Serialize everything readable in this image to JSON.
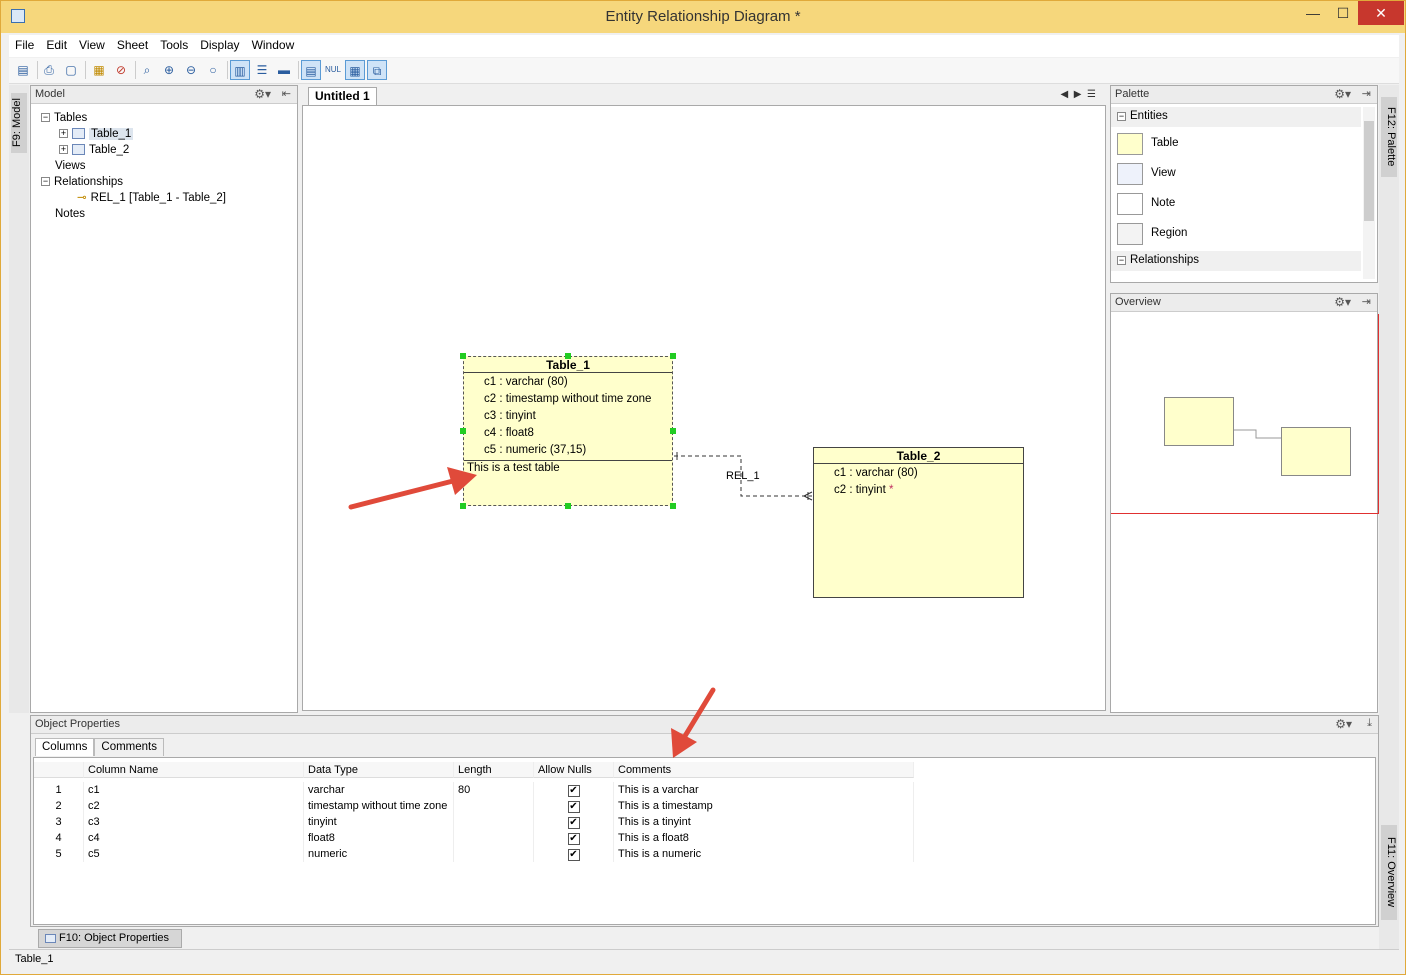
{
  "window": {
    "title": "Entity Relationship Diagram *",
    "minimize": "—",
    "maximize": "☐",
    "close": "✕"
  },
  "menu": [
    "File",
    "Edit",
    "View",
    "Sheet",
    "Tools",
    "Display",
    "Window"
  ],
  "side_left": {
    "model_tab": "F9: Model"
  },
  "side_right": {
    "palette_tab": "F12: Palette",
    "overview_tab": "F11: Overview"
  },
  "model_panel": {
    "title": "Model",
    "tree": {
      "tables": "Tables",
      "table_items": [
        "Table_1",
        "Table_2"
      ],
      "views": "Views",
      "relationships": "Relationships",
      "rel_item": "REL_1 [Table_1 - Table_2]",
      "notes": "Notes"
    }
  },
  "document": {
    "tab": "Untitled 1"
  },
  "diagram": {
    "table1": {
      "name": "Table_1",
      "columns": [
        "c1 : varchar (80)",
        "c2 : timestamp without time zone",
        "c3 : tinyint",
        "c4 : float8",
        "c5 : numeric (37,15)"
      ],
      "note": "This is a test table"
    },
    "table2": {
      "name": "Table_2",
      "columns": [
        "c1 : varchar (80)",
        "c2 : tinyint"
      ],
      "required_marker": "*"
    },
    "relationship_label": "REL_1"
  },
  "palette": {
    "title": "Palette",
    "entities_section": "Entities",
    "items": [
      "Table",
      "View",
      "Note",
      "Region"
    ],
    "relationships_section": "Relationships"
  },
  "overview": {
    "title": "Overview"
  },
  "properties": {
    "title": "Object Properties",
    "tabs": [
      "Columns",
      "Comments"
    ],
    "headers": [
      "Column Name",
      "Data Type",
      "Length",
      "Allow Nulls",
      "Comments"
    ],
    "rows": [
      {
        "n": "1",
        "name": "c1",
        "type": "varchar",
        "length": "80",
        "nulls": "✔",
        "comment": "This is a varchar"
      },
      {
        "n": "2",
        "name": "c2",
        "type": "timestamp without time zone",
        "length": "",
        "nulls": "✔",
        "comment": "This is a timestamp"
      },
      {
        "n": "3",
        "name": "c3",
        "type": "tinyint",
        "length": "",
        "nulls": "✔",
        "comment": "This is a tinyint"
      },
      {
        "n": "4",
        "name": "c4",
        "type": "float8",
        "length": "",
        "nulls": "✔",
        "comment": "This is a float8"
      },
      {
        "n": "5",
        "name": "c5",
        "type": "numeric",
        "length": "",
        "nulls": "✔",
        "comment": "This is a numeric"
      }
    ]
  },
  "bottom_tab": "F10: Object Properties",
  "status": "Table_1",
  "colors": {
    "entity_fill": "#ffffcc",
    "selection": "#22cc22",
    "arrow": "#e04a3a",
    "titlebar": "#f6d77c"
  }
}
